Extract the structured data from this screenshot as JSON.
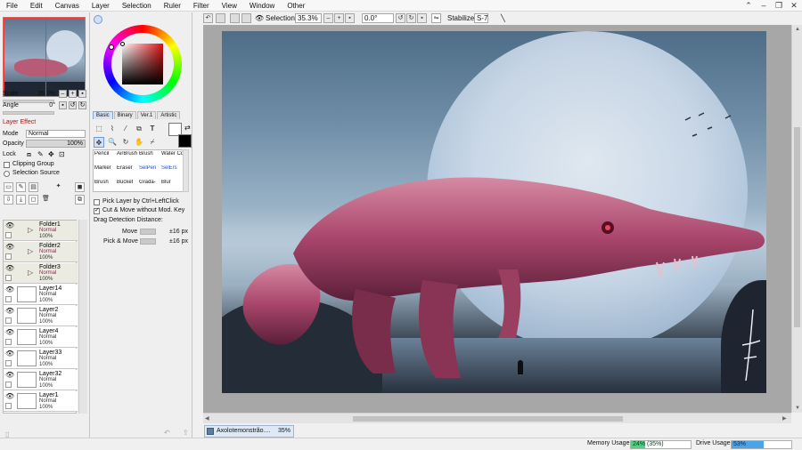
{
  "menu": {
    "items": [
      "File",
      "Edit",
      "Canvas",
      "Layer",
      "Selection",
      "Ruler",
      "Filter",
      "View",
      "Window",
      "Other"
    ],
    "controls": [
      "⌃",
      "–",
      "❐",
      "✕"
    ]
  },
  "navigator": {
    "scale_label": "Scale",
    "scale_value": "35.3%",
    "angle_label": "Angle",
    "angle_value": "0°"
  },
  "layer_panel": {
    "effect_label": "Layer Effect",
    "mode_label": "Mode",
    "mode_value": "Normal",
    "opacity_label": "Opacity",
    "opacity_value": "100%",
    "lock_label": "Lock",
    "clipping_label": "Clipping Group",
    "selection_source_label": "Selection Source",
    "layers": [
      {
        "name": "Folder1",
        "mode": "Normal",
        "opacity": "100%",
        "folder": true
      },
      {
        "name": "Folder2",
        "mode": "Normal",
        "opacity": "100%",
        "folder": true
      },
      {
        "name": "Folder3",
        "mode": "Normal",
        "opacity": "100%",
        "folder": true
      },
      {
        "name": "Layer14",
        "mode": "Normal",
        "opacity": "100%",
        "folder": false
      },
      {
        "name": "Layer2",
        "mode": "Normal",
        "opacity": "100%",
        "folder": false
      },
      {
        "name": "Layer4",
        "mode": "Normal",
        "opacity": "100%",
        "folder": false
      },
      {
        "name": "Layer33",
        "mode": "Normal",
        "opacity": "100%",
        "folder": false
      },
      {
        "name": "Layer32",
        "mode": "Normal",
        "opacity": "100%",
        "folder": false
      },
      {
        "name": "Layer1",
        "mode": "Normal",
        "opacity": "100%",
        "folder": false
      }
    ]
  },
  "tool_panel": {
    "tabs": [
      "Basic",
      "Binary",
      "Ver.1",
      "Artistic"
    ],
    "brushes": [
      {
        "label": "Pencil",
        "blue": false
      },
      {
        "label": "AirBrush",
        "blue": false
      },
      {
        "label": "Brush",
        "blue": false
      },
      {
        "label": "Water Color",
        "blue": false
      },
      {
        "label": "Marker",
        "blue": false
      },
      {
        "label": "Eraser",
        "blue": false
      },
      {
        "label": "SelPen",
        "blue": true
      },
      {
        "label": "SelErs",
        "blue": true
      },
      {
        "label": "Brush",
        "blue": false
      },
      {
        "label": "Bucket",
        "blue": false
      },
      {
        "label": "Grada-",
        "blue": false
      },
      {
        "label": "Blur",
        "blue": false
      }
    ],
    "pick_layer_label": "Pick Layer by Ctrl+LeftClick",
    "cut_move_label": "Cut & Move without Mod. Key",
    "drag_detection_label": "Drag Detection Distance:",
    "move_label": "Move",
    "move_value": "±16 px",
    "pick_move_label": "Pick & Move",
    "pick_move_value": "±16 px"
  },
  "toolbar": {
    "selection_label": "Selection",
    "zoom_value": "35.3%",
    "angle_value": "0.0°",
    "stabilizer_label": "Stabilizer",
    "stabilizer_value": "S-7"
  },
  "document": {
    "tab_name": "Axolotemonstrão....",
    "tab_zoom": "35%"
  },
  "status": {
    "memory_label": "Memory Usage",
    "memory_value": "24% (35%)",
    "memory_fraction": 0.24,
    "drive_label": "Drive Usage",
    "drive_value": "53%",
    "drive_fraction": 0.53
  },
  "colors": {
    "accent": "#6f9bd6",
    "creature": "#b65a78",
    "memory_bar": "#4fd181",
    "drive_bar": "#4aa5e8"
  }
}
